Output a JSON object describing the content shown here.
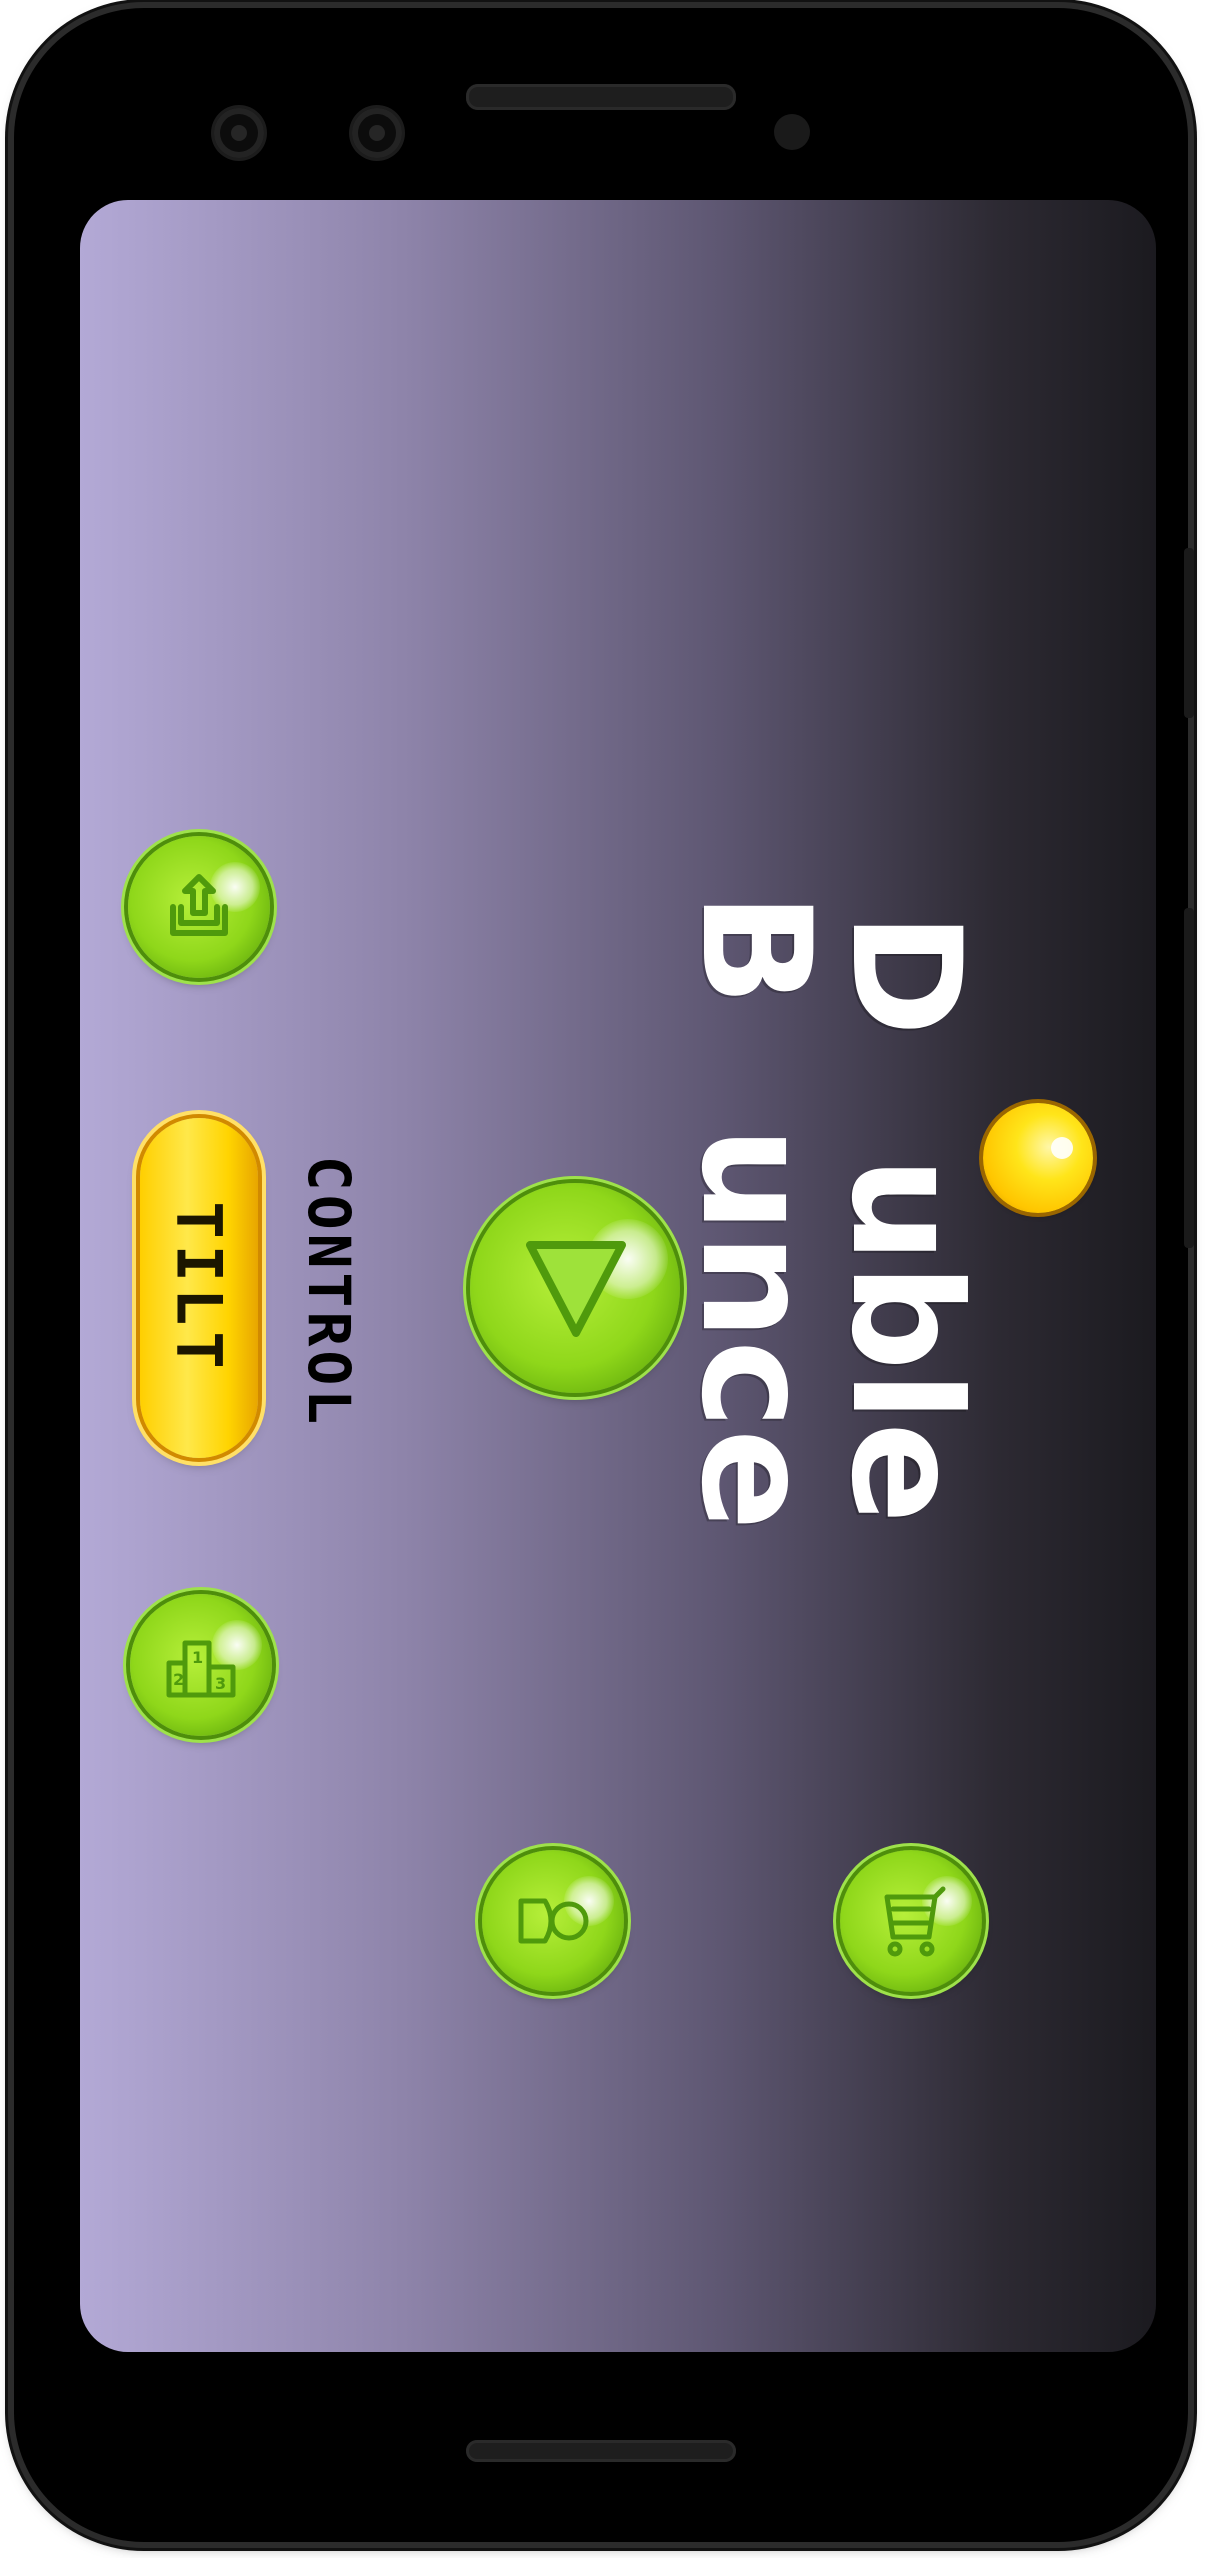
{
  "app": {
    "title_line_1": "D uble",
    "title_line_2": "B unce",
    "title_parts": {
      "line1_prefix": "D",
      "line1_suffix": "uble",
      "line2_prefix": "B",
      "line2_suffix": "unce"
    }
  },
  "menu": {
    "control_label": "CONTROL",
    "tilt_label": "TILT",
    "icons": {
      "share": "share-upload-icon",
      "play": "play-triangle-icon",
      "leaderboard": "podium-leaderboard-icon",
      "skins": "character-skin-icon",
      "shop": "shopping-cart-icon"
    }
  },
  "colors": {
    "button_green": "#8fd71a",
    "tilt_yellow": "#ffd400",
    "ball_yellow": "#ffe51a",
    "bg_left": "#b3a9d6",
    "bg_right": "#1b1a1f"
  }
}
